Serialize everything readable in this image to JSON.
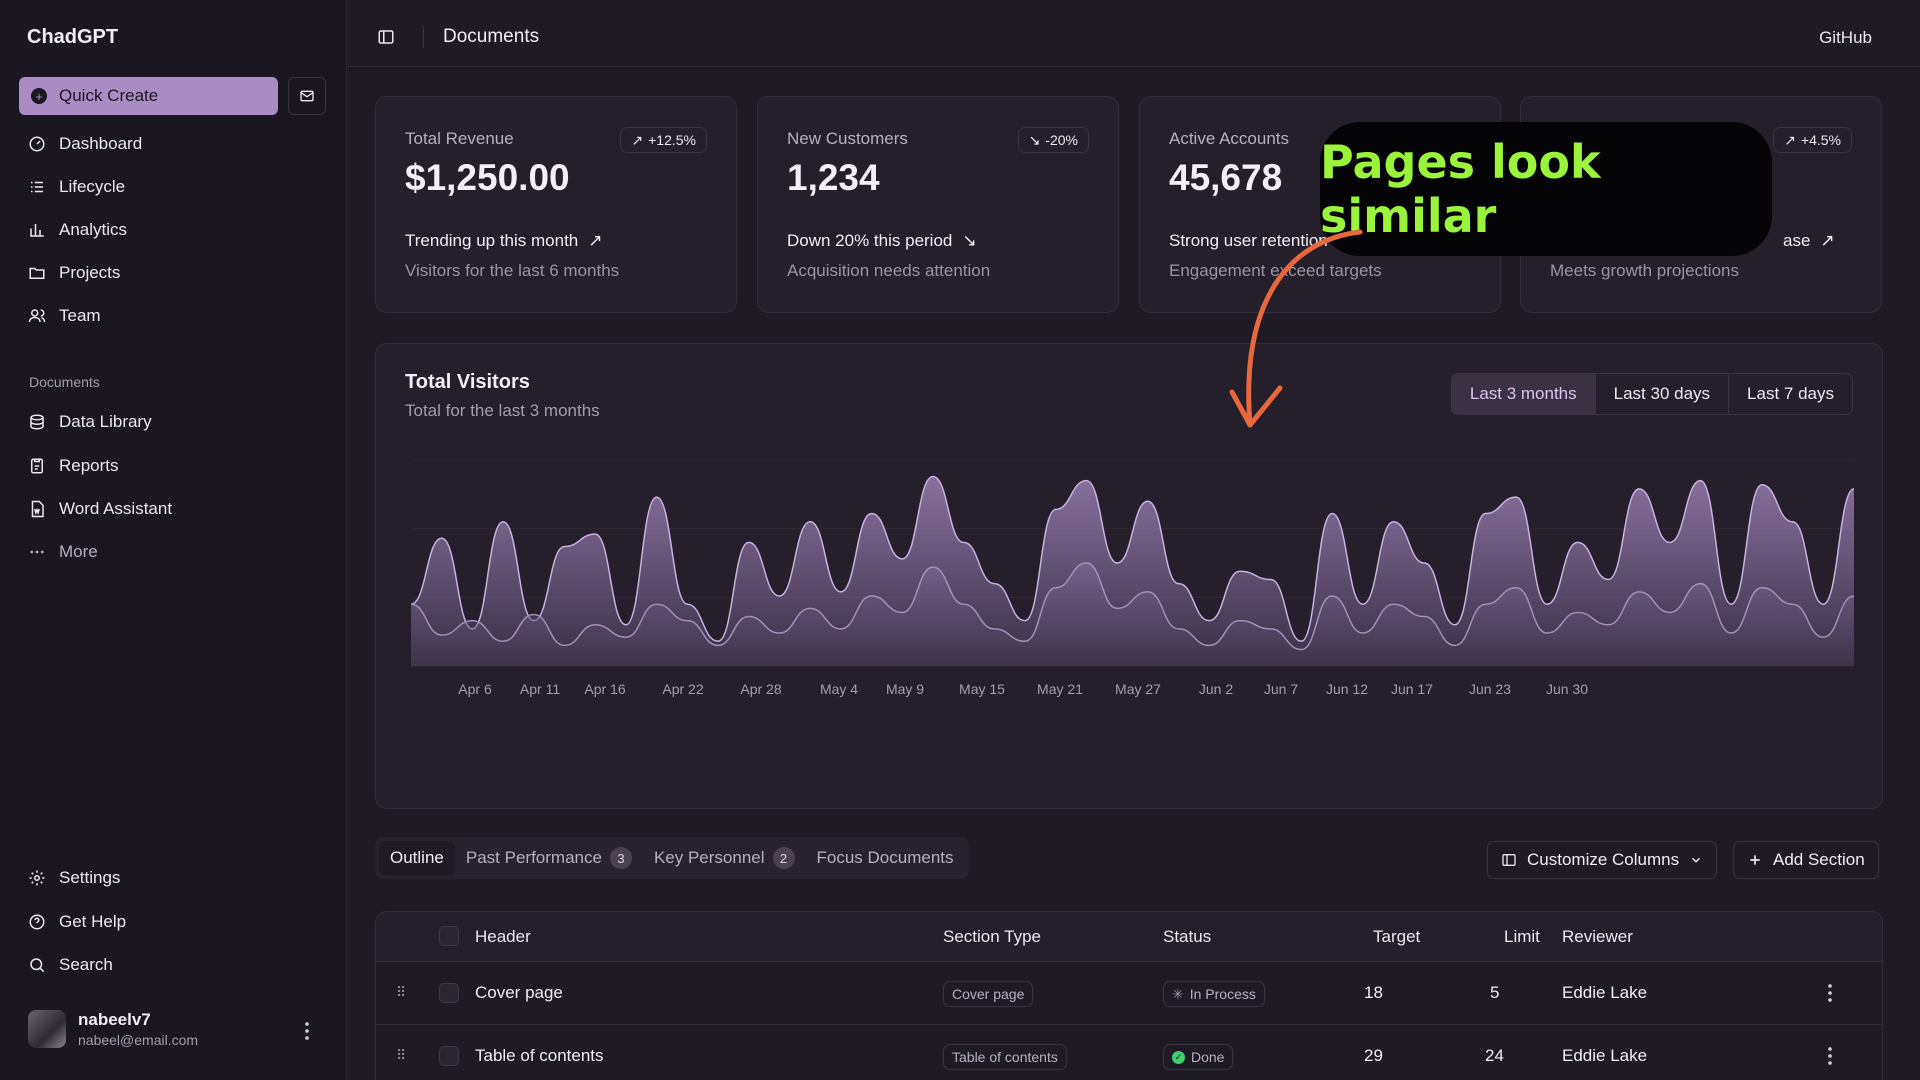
{
  "app": {
    "title": "ChadGPT"
  },
  "sidebar": {
    "quick_create": "Quick Create",
    "items": [
      {
        "label": "Dashboard",
        "icon": "gauge-icon"
      },
      {
        "label": "Lifecycle",
        "icon": "list-icon"
      },
      {
        "label": "Analytics",
        "icon": "bar-chart-icon"
      },
      {
        "label": "Projects",
        "icon": "folder-icon"
      },
      {
        "label": "Team",
        "icon": "users-icon"
      }
    ],
    "documents_heading": "Documents",
    "documents": [
      {
        "label": "Data Library",
        "icon": "database-icon"
      },
      {
        "label": "Reports",
        "icon": "report-icon"
      },
      {
        "label": "Word Assistant",
        "icon": "file-word-icon"
      },
      {
        "label": "More",
        "icon": "more-horizontal-icon"
      }
    ],
    "bottom": [
      {
        "label": "Settings",
        "icon": "gear-icon"
      },
      {
        "label": "Get Help",
        "icon": "help-icon"
      },
      {
        "label": "Search",
        "icon": "search-icon"
      }
    ],
    "user": {
      "name": "nabeelv7",
      "email": "nabeel@email.com"
    }
  },
  "header": {
    "title": "Documents",
    "github": "GitHub"
  },
  "cards": [
    {
      "label": "Total Revenue",
      "value": "$1,250.00",
      "badge": "+12.5%",
      "trend_dir": "up",
      "trend": "Trending up this month",
      "sub": "Visitors for the last 6 months"
    },
    {
      "label": "New Customers",
      "value": "1,234",
      "badge": "-20%",
      "trend_dir": "down",
      "trend": "Down 20% this period",
      "sub": "Acquisition needs attention"
    },
    {
      "label": "Active Accounts",
      "value": "45,678",
      "badge": "",
      "trend_dir": "up",
      "trend": "Strong user retention",
      "sub": "Engagement exceed targets"
    },
    {
      "label": "",
      "value": "",
      "badge": "+4.5%",
      "trend_dir": "up",
      "trend": "ase",
      "sub": "Meets growth projections"
    }
  ],
  "chart": {
    "title": "Total Visitors",
    "subtitle": "Total for the last 3 months",
    "ranges": [
      "Last 3 months",
      "Last 30 days",
      "Last 7 days"
    ],
    "active_range": 0,
    "accent": "#a98cc6"
  },
  "chart_data": {
    "type": "area",
    "x_ticks": [
      "Apr 6",
      "Apr 11",
      "Apr 16",
      "Apr 22",
      "Apr 28",
      "May 4",
      "May 9",
      "May 15",
      "May 21",
      "May 27",
      "Jun 2",
      "Jun 7",
      "Jun 12",
      "Jun 17",
      "Jun 23",
      "Jun 30"
    ],
    "series": [
      {
        "values": [
          0.3,
          0.62,
          0.18,
          0.7,
          0.22,
          0.58,
          0.64,
          0.2,
          0.82,
          0.3,
          0.12,
          0.6,
          0.34,
          0.7,
          0.36,
          0.74,
          0.52,
          0.92,
          0.6,
          0.4,
          0.22,
          0.76,
          0.9,
          0.5,
          0.8,
          0.4,
          0.22,
          0.46,
          0.42,
          0.12,
          0.74,
          0.3,
          0.7,
          0.5,
          0.2,
          0.74,
          0.82,
          0.3,
          0.6,
          0.42,
          0.86,
          0.6,
          0.9,
          0.3,
          0.88,
          0.7,
          0.3,
          0.86
        ]
      },
      {
        "values": [
          0.3,
          0.15,
          0.22,
          0.12,
          0.25,
          0.1,
          0.2,
          0.14,
          0.3,
          0.22,
          0.1,
          0.24,
          0.16,
          0.28,
          0.18,
          0.34,
          0.26,
          0.48,
          0.3,
          0.18,
          0.12,
          0.38,
          0.5,
          0.28,
          0.36,
          0.18,
          0.1,
          0.22,
          0.18,
          0.08,
          0.34,
          0.16,
          0.3,
          0.24,
          0.1,
          0.3,
          0.38,
          0.16,
          0.26,
          0.2,
          0.36,
          0.26,
          0.4,
          0.16,
          0.38,
          0.3,
          0.14,
          0.34
        ]
      }
    ]
  },
  "tabs": [
    {
      "label": "Outline",
      "count": ""
    },
    {
      "label": "Past Performance",
      "count": "3"
    },
    {
      "label": "Key Personnel",
      "count": "2"
    },
    {
      "label": "Focus Documents",
      "count": ""
    }
  ],
  "toolbar": {
    "customize": "Customize Columns",
    "add_section": "Add Section"
  },
  "table": {
    "columns": [
      "Header",
      "Section Type",
      "Status",
      "Target",
      "Limit",
      "Reviewer"
    ],
    "rows": [
      {
        "header": "Cover page",
        "type": "Cover page",
        "status": "In Process",
        "target": "18",
        "limit": "5",
        "reviewer": "Eddie Lake"
      },
      {
        "header": "Table of contents",
        "type": "Table of contents",
        "status": "Done",
        "target": "29",
        "limit": "24",
        "reviewer": "Eddie Lake"
      }
    ]
  },
  "annotation": {
    "text": "Pages look similar"
  }
}
